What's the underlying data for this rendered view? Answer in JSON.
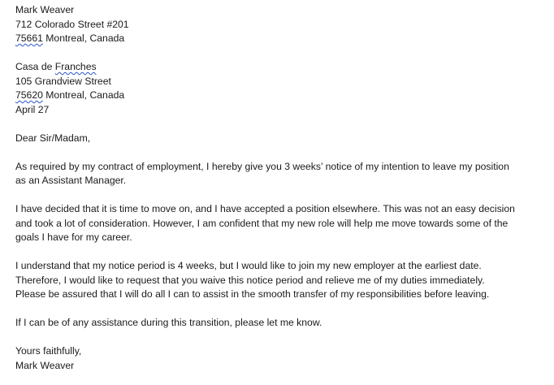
{
  "sender": {
    "name": "Mark Weaver",
    "street": "712 Colorado Street #201",
    "postcode": "75661",
    "city": " Montreal, Canada"
  },
  "recipient": {
    "name_prefix": "Casa de ",
    "name_flagged": "Franches",
    "street": "105 Grandview Street",
    "postcode": "75620",
    "city": " Montreal, Canada",
    "date": "April 27"
  },
  "salutation": "Dear Sir/Madam,",
  "paragraphs": {
    "p1_l1": "As required by my contract of employment, I hereby give you 3 weeks’ notice of my intention to leave my position",
    "p1_l2": "as an Assistant Manager.",
    "p2_l1": "I have decided that it is time to move on, and I have accepted a position elsewhere. This was not an easy decision",
    "p2_l2": "and took a lot of consideration. However, I am confident that my new role will help me move towards some of the",
    "p2_l3": "goals I have for my career.",
    "p3_l1": "I understand that my notice period is 4 weeks, but I would like to join my new employer at the earliest date.",
    "p3_l2": "Therefore, I would like to request that you waive this notice period and relieve me of my duties immediately.",
    "p3_l3": "Please be assured that I will do all I can to assist in the smooth transfer of my responsibilities before leaving.",
    "p4_l1": "If I can be of any assistance during this transition, please let me know."
  },
  "closing": "Yours faithfully,",
  "signature": "Mark Weaver"
}
